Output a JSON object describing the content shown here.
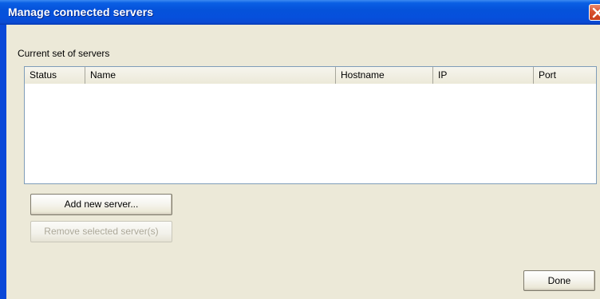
{
  "window": {
    "title": "Manage connected servers",
    "close_icon": "close-icon"
  },
  "section": {
    "label": "Current set of servers"
  },
  "server_list": {
    "columns": [
      "Status",
      "Name",
      "Hostname",
      "IP",
      "Port"
    ],
    "rows": []
  },
  "buttons": {
    "add": "Add new server...",
    "remove": "Remove selected server(s)",
    "done": "Done"
  },
  "colors": {
    "titlebar": "#0552da",
    "client_background": "#ece9d8",
    "close_button": "#d8512f",
    "disabled_text": "#aca899"
  }
}
